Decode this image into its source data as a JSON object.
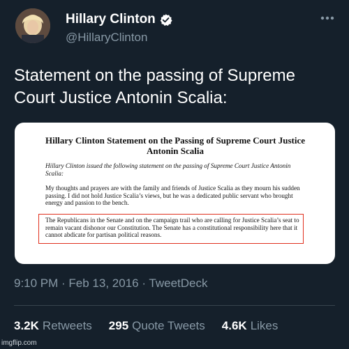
{
  "author": {
    "display_name": "Hillary Clinton",
    "handle": "@HillaryClinton",
    "verified_icon": "verified-badge-icon",
    "avatar_icon": "profile-photo"
  },
  "tweet": {
    "text": "Statement on the passing of Supreme Court Justice Antonin Scalia:",
    "timestamp": "9:10 PM · Feb 13, 2016 · TweetDeck"
  },
  "media": {
    "title": "Hillary Clinton Statement on the Passing of Supreme Court Justice Antonin Scalia",
    "intro": "Hillary Clinton issued the following statement on the passing of Supreme Court Justice Antonin Scalia:",
    "paragraph1": "My thoughts and prayers are with the family and friends of Justice Scalia as they mourn his sudden passing. I did not hold Justice Scalia’s views, but he was a dedicated public servant who brought energy and passion to the bench.",
    "paragraph2": "The Republicans in the Senate and on the campaign trail who are calling for Justice Scalia’s seat to remain vacant dishonor our Constitution.  The Senate has a constitutional responsibility here that it cannot abdicate for partisan political reasons.",
    "highlight_color": "#e0301e"
  },
  "stats": {
    "retweets_count": "3.2K",
    "retweets_label": "Retweets",
    "quotes_count": "295",
    "quotes_label": "Quote Tweets",
    "likes_count": "4.6K",
    "likes_label": "Likes"
  },
  "watermark": "imgflip.com",
  "colors": {
    "background": "#15202b",
    "secondary_text": "#8899a6",
    "verified_blue": "#ffffff",
    "divider": "#38444d"
  }
}
